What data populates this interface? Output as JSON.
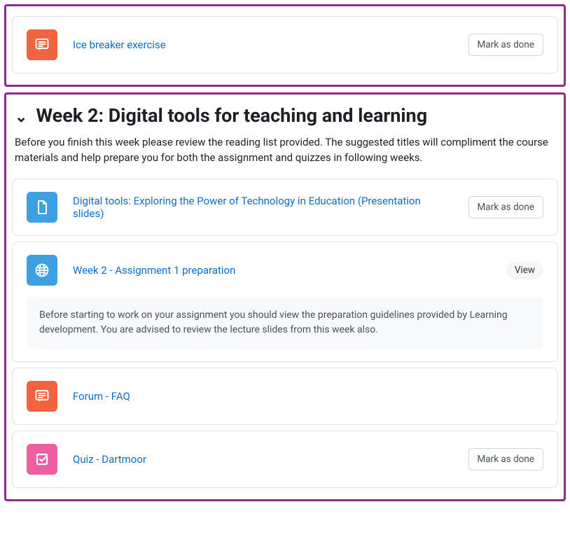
{
  "buttons": {
    "mark_as_done": "Mark as done",
    "view": "View"
  },
  "section1": {
    "activities": [
      {
        "title": "Ice breaker exercise"
      }
    ]
  },
  "section2": {
    "title": "Week 2: Digital tools for teaching and learning",
    "description": "Before you finish this week please review the reading list provided. The suggested titles will compliment the course materials and help prepare you for both the assignment and quizzes in following weeks.",
    "activities": [
      {
        "title": "Digital tools: Exploring  the Power of Technology in Education (Presentation slides)"
      },
      {
        "title": "Week 2 - Assignment 1 preparation",
        "desc": "Before starting to work on your assignment you should view the preparation guidelines provided by Learning development. You are advised to review the lecture slides from this week also."
      },
      {
        "title": "Forum - FAQ"
      },
      {
        "title": "Quiz - Dartmoor"
      }
    ]
  }
}
